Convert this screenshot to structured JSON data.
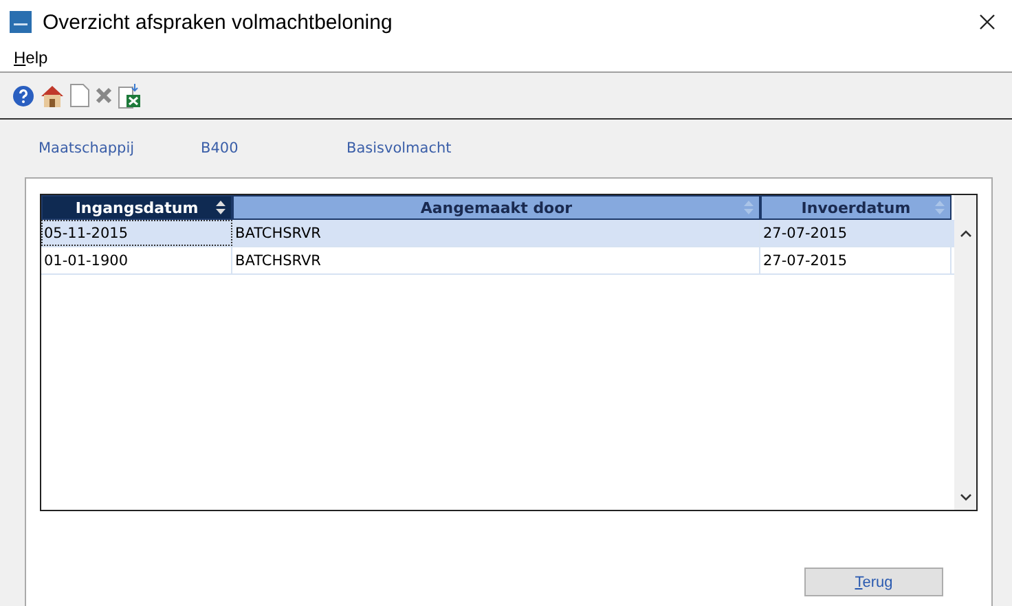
{
  "window": {
    "title": "Overzicht afspraken volmachtbeloning"
  },
  "menu": [
    {
      "label": "Help",
      "first_letter_underlined": true
    }
  ],
  "toolbar": [
    {
      "kind": "help"
    },
    {
      "kind": "home"
    },
    {
      "kind": "new"
    },
    {
      "kind": "delete"
    },
    {
      "kind": "excel"
    }
  ],
  "info": [
    "Maatschappij",
    "B400",
    "Basisvolmacht"
  ],
  "table": {
    "columns": [
      {
        "label": "Ingangsdatum",
        "sorted": true
      },
      {
        "label": "Aangemaakt door",
        "sorted": false
      },
      {
        "label": "Invoerdatum",
        "sorted": false
      }
    ],
    "rows": [
      {
        "cells": [
          "05-11-2015",
          "BATCHSRVR",
          "27-07-2015"
        ],
        "selected": true
      },
      {
        "cells": [
          "01-01-1900",
          "BATCHSRVR",
          "27-07-2015"
        ],
        "selected": false
      }
    ]
  },
  "buttons": [
    {
      "label": "Terug",
      "first_letter_underlined": true
    }
  ]
}
